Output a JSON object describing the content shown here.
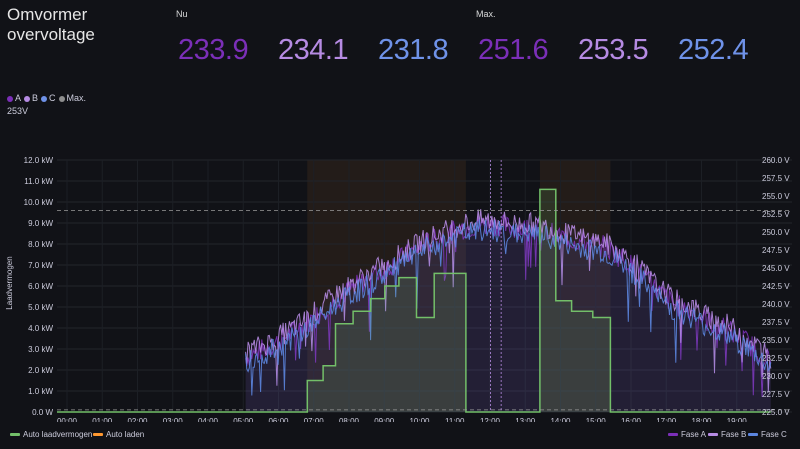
{
  "panel": {
    "title_line1": "Omvormer",
    "title_line2": "overvoltage"
  },
  "stats": {
    "now_label": "Nu",
    "max_label": "Max.",
    "now": [
      {
        "phase": "A",
        "value": "233.9",
        "color": "#7b2fb8"
      },
      {
        "phase": "B",
        "value": "234.1",
        "color": "#b68be3"
      },
      {
        "phase": "C",
        "value": "231.8",
        "color": "#6f92e8"
      }
    ],
    "max": [
      {
        "phase": "A",
        "value": "251.6",
        "color": "#7b2fb8"
      },
      {
        "phase": "B",
        "value": "253.5",
        "color": "#b68be3"
      },
      {
        "phase": "C",
        "value": "252.4",
        "color": "#6f92e8"
      }
    ]
  },
  "top_legend": {
    "items": [
      {
        "label": "A",
        "color": "#7b2fb8"
      },
      {
        "label": "B",
        "color": "#b68be3"
      },
      {
        "label": "C",
        "color": "#6f92e8"
      },
      {
        "label": "Max.",
        "color": "#8e8e8e"
      }
    ],
    "threshold_label": "253V"
  },
  "chart_data": {
    "type": "line",
    "y_left": {
      "label": "Laadvermogen",
      "ticks": [
        "0.0 W",
        "1.0 kW",
        "2.0 kW",
        "3.0 kW",
        "4.0 kW",
        "5.0 kW",
        "6.0 kW",
        "7.0 kW",
        "8.0 kW",
        "9.0 kW",
        "10.0 kW",
        "11.0 kW",
        "12.0 kW"
      ],
      "range": [
        0,
        12
      ]
    },
    "y_right": {
      "ticks": [
        "225.0 V",
        "227.5 V",
        "230.0 V",
        "232.5 V",
        "235.0 V",
        "237.5 V",
        "240.0 V",
        "242.5 V",
        "245.0 V",
        "247.5 V",
        "250.0 V",
        "252.5 V",
        "255.0 V",
        "257.5 V",
        "260.0 V"
      ],
      "range": [
        225,
        260
      ]
    },
    "x_ticks": [
      "00:00",
      "01:00",
      "02:00",
      "03:00",
      "04:00",
      "05:00",
      "06:00",
      "07:00",
      "08:00",
      "09:00",
      "10:00",
      "11:00",
      "12:00",
      "13:00",
      "14:00",
      "15:00",
      "16:00",
      "17:00",
      "18:00",
      "19:00"
    ],
    "x_range_hours": [
      0,
      20.25
    ],
    "thresholds_voltage": [
      253,
      225.3
    ],
    "shaded_periods_hours": [
      [
        7.1,
        11.6
      ],
      [
        13.7,
        15.7
      ]
    ],
    "power_series": {
      "name": "Auto laadvermogen",
      "color": "#73bf69",
      "steps": [
        [
          0,
          0
        ],
        [
          7.1,
          0
        ],
        [
          7.1,
          1.5
        ],
        [
          7.55,
          1.5
        ],
        [
          7.55,
          2.2
        ],
        [
          7.9,
          2.2
        ],
        [
          7.9,
          4.2
        ],
        [
          8.4,
          4.2
        ],
        [
          8.4,
          4.8
        ],
        [
          8.9,
          4.8
        ],
        [
          8.9,
          5.4
        ],
        [
          9.3,
          5.4
        ],
        [
          9.3,
          6.0
        ],
        [
          9.7,
          6.0
        ],
        [
          9.7,
          6.4
        ],
        [
          10.2,
          6.4
        ],
        [
          10.2,
          4.5
        ],
        [
          10.7,
          4.5
        ],
        [
          10.7,
          6.6
        ],
        [
          11.6,
          6.6
        ],
        [
          11.6,
          0
        ],
        [
          13.7,
          0
        ],
        [
          13.7,
          10.6
        ],
        [
          14.15,
          10.6
        ],
        [
          14.15,
          5.3
        ],
        [
          14.6,
          5.3
        ],
        [
          14.6,
          4.8
        ],
        [
          15.2,
          4.8
        ],
        [
          15.2,
          4.5
        ],
        [
          15.7,
          4.5
        ],
        [
          15.7,
          0
        ],
        [
          20.25,
          0
        ]
      ]
    },
    "series": [
      {
        "name": "Fase A",
        "color": "#7b2fb8"
      },
      {
        "name": "Fase B",
        "color": "#b68be3"
      },
      {
        "name": "Fase C",
        "color": "#5c86e0"
      }
    ],
    "voltage_profile": [
      [
        5.35,
        232.5
      ],
      [
        5.5,
        233.0
      ],
      [
        6.0,
        234.0
      ],
      [
        6.5,
        235.5
      ],
      [
        7.0,
        237.0
      ],
      [
        7.5,
        239.0
      ],
      [
        8.0,
        241.0
      ],
      [
        8.5,
        242.5
      ],
      [
        9.0,
        244.0
      ],
      [
        9.5,
        245.5
      ],
      [
        10.0,
        247.0
      ],
      [
        10.5,
        248.5
      ],
      [
        11.0,
        249.5
      ],
      [
        11.5,
        250.5
      ],
      [
        12.0,
        251.0
      ],
      [
        12.5,
        251.0
      ],
      [
        13.0,
        250.5
      ],
      [
        13.5,
        250.5
      ],
      [
        14.0,
        250.0
      ],
      [
        14.5,
        249.0
      ],
      [
        15.0,
        248.5
      ],
      [
        15.5,
        248.0
      ],
      [
        16.0,
        246.5
      ],
      [
        16.5,
        244.5
      ],
      [
        17.0,
        242.0
      ],
      [
        17.5,
        240.0
      ],
      [
        18.0,
        239.0
      ],
      [
        18.5,
        237.5
      ],
      [
        19.0,
        236.5
      ],
      [
        19.5,
        235.0
      ],
      [
        20.0,
        233.0
      ],
      [
        20.25,
        232.0
      ]
    ],
    "legend_bottom_left": [
      {
        "name": "Auto laadvermogen",
        "color": "#73bf69"
      },
      {
        "name": "Auto laden",
        "color": "#ff9830"
      }
    ]
  }
}
